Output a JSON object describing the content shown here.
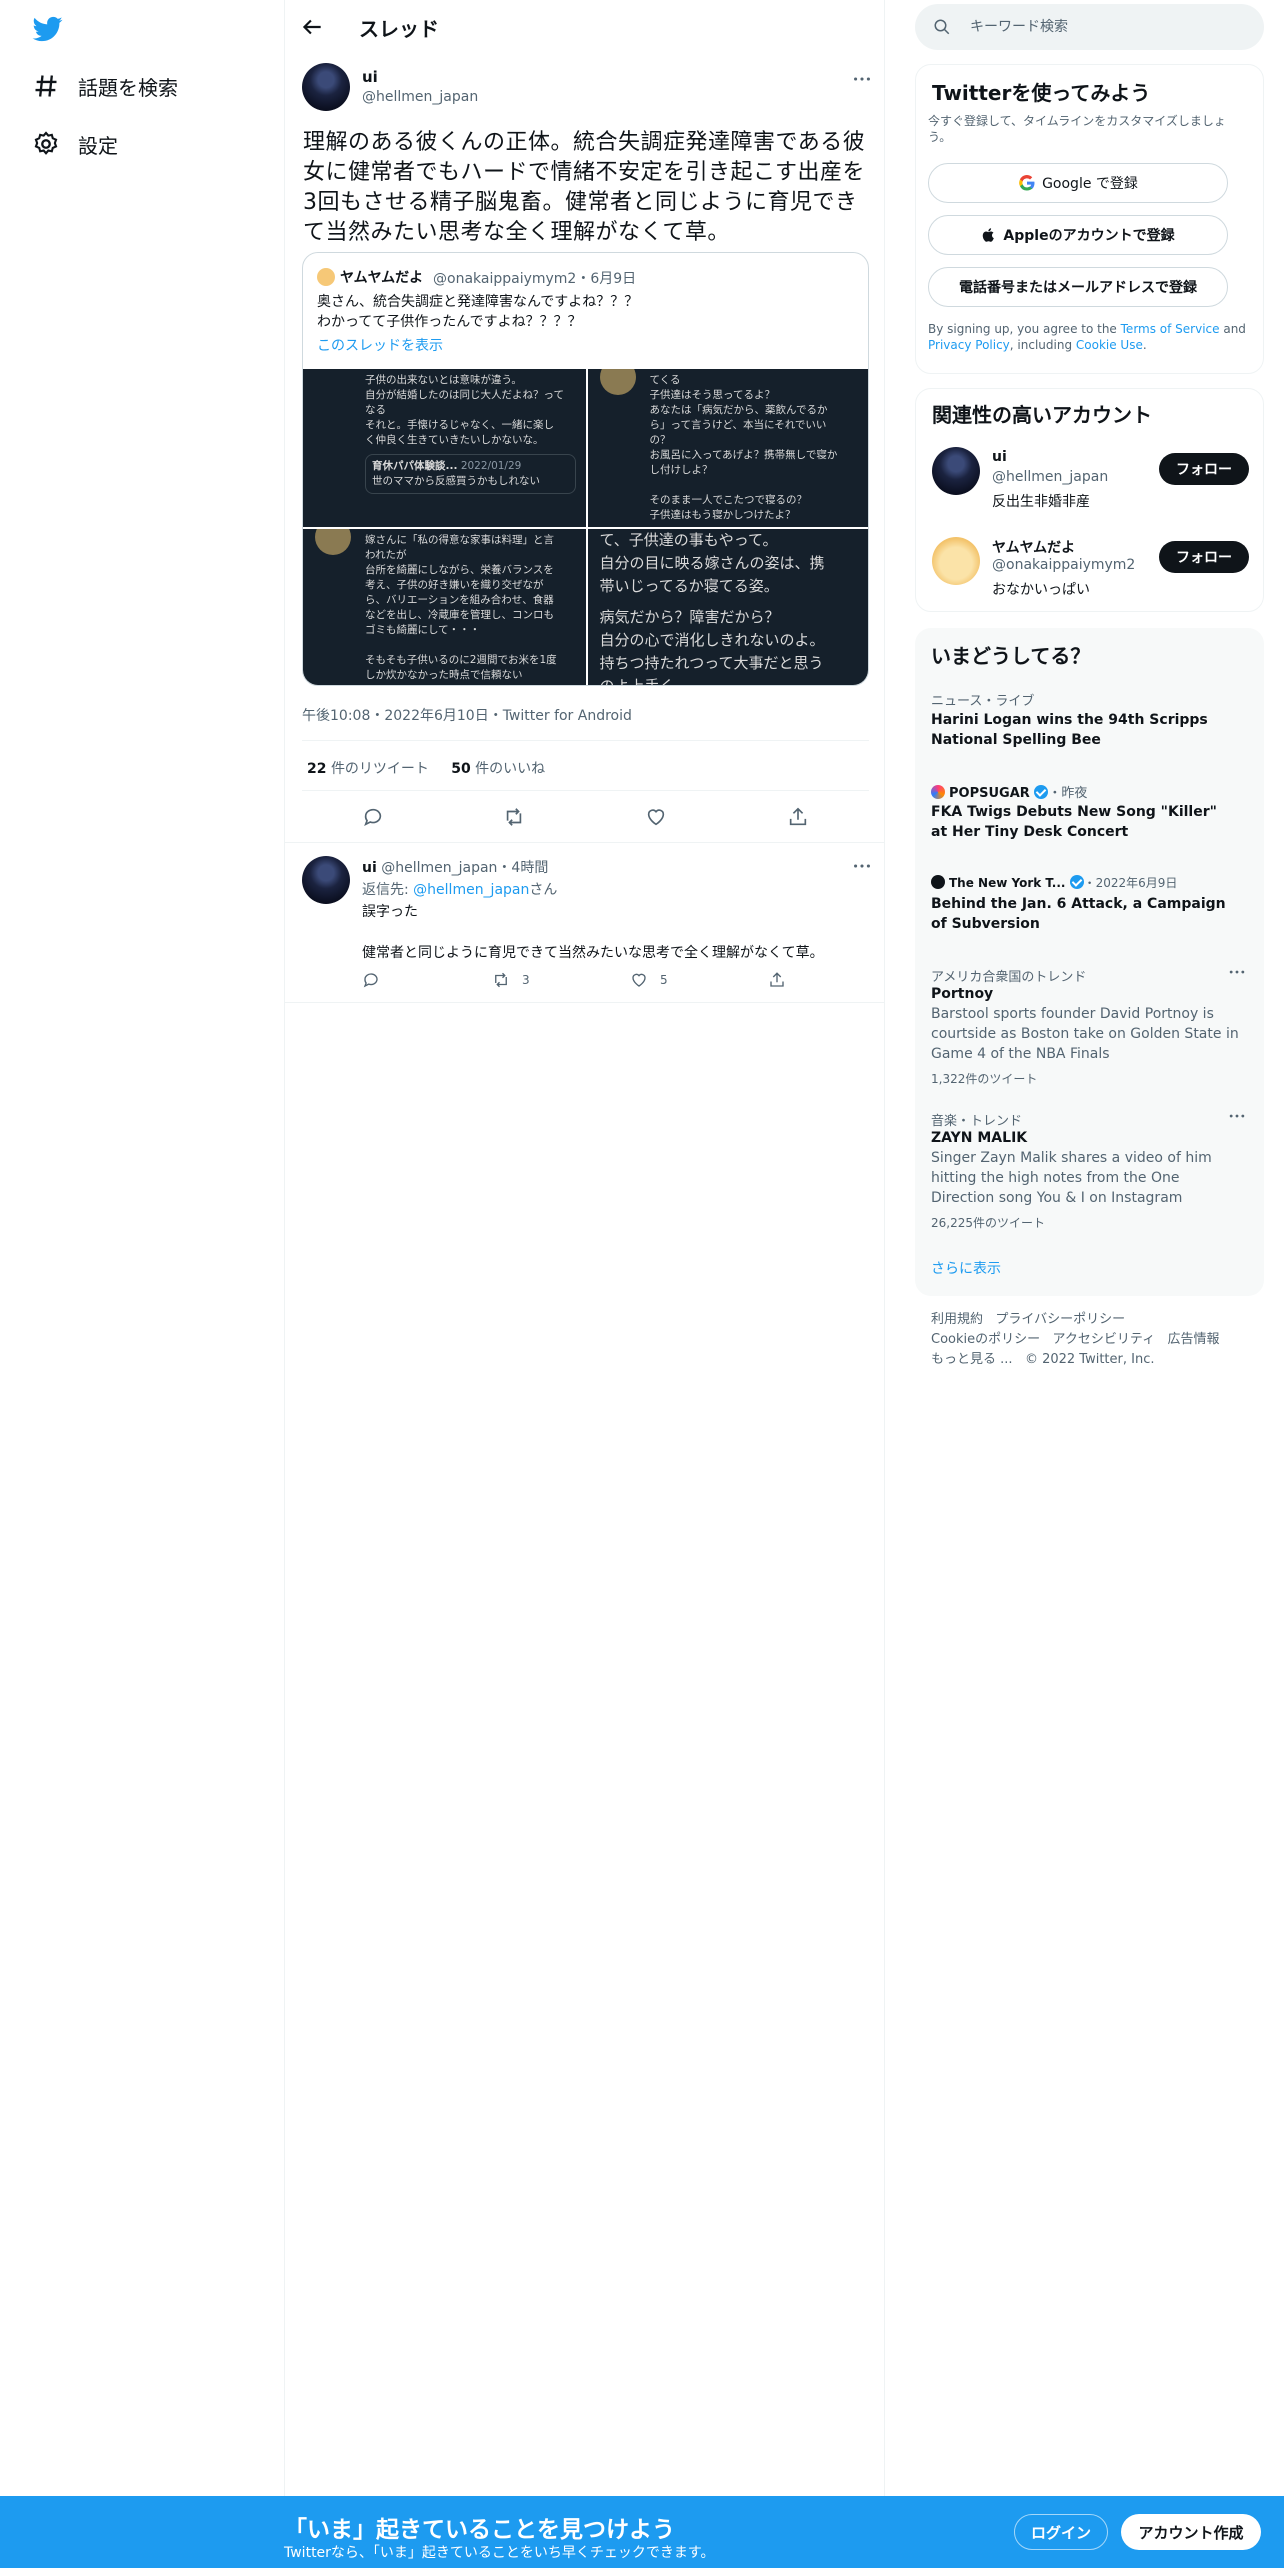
{
  "nav": {
    "explore_label": "話題を検索",
    "settings_label": "設定"
  },
  "header": {
    "title": "スレッド"
  },
  "main_tweet": {
    "name": "ui",
    "handle": "@hellmen_japan",
    "text": "理解のある彼くんの正体。統合失調症発達障害である彼女に健常者でもハードで情緒不安定を引き起こす出産を3回もさせる精子脳鬼畜。健常者と同じように育児できて当然みたい思考な全く理解がなくて草。",
    "timestamp": "午後10:08・2022年6月10日・Twitter for Android",
    "retweets_count": "22",
    "retweets_label": "件のリツイート",
    "likes_count": "50",
    "likes_label": "件のいいね"
  },
  "quote": {
    "name": "ヤムヤムだよ",
    "meta": "@onakaippaiymym2・6月9日",
    "line1": "奥さん、統合失調症と発達障害なんですよね？？？",
    "line2": "わかってて子供作ったんですよね？？？？",
    "link": "このスレッドを表示",
    "images": [
      {
        "lines": [
          "子供の出来ないとは意味が違う。",
          "自分が結婚したのは同じ大人だよね？って",
          "なる",
          "",
          "それと。手懐けるじゃなく、一緒に楽し",
          "く仲良く生きていきたいしかないな。"
        ],
        "embed_name": "育休パパ体験談...",
        "embed_date": "2022/01/29",
        "embed_text": "世のママから反感買うかもしれない"
      },
      {
        "lines": [
          "てくる",
          "子供達はそう思ってるよ？",
          "あなたは「病気だから、薬飲んでるか",
          "ら」って言うけど、本当にそれでいい",
          "の？",
          "お風呂に入ってあげよ？携帯無しで寝か",
          "し付けしよ？",
          "",
          "そのまま一人でこたつで寝るの？",
          "子供達はもう寝かしつけたよ？"
        ]
      },
      {
        "lines": [
          "嫁さんに「私の得意な家事は料理」と言",
          "われたが",
          "台所を綺麗にしながら、栄養バランスを",
          "考え、子供の好き嫌いを織り交ぜなが",
          "ら、バリエーションを組み合わせ、食器",
          "などを出し、冷蔵庫を管理し、コンロも",
          "ゴミも綺麗にして・・・",
          "",
          "そもそも子供いるのに2週間でお米を1度",
          "しか炊かなかった時点で信頼ない"
        ]
      },
      {
        "lines": [
          "て、子供達の事もやって。",
          "自分の目に映る嫁さんの姿は、携",
          "帯いじってるか寝てる姿。",
          "",
          "病気だから？障害だから？",
          "自分の心で消化しきれないのよ。",
          "持ちつ持たれつって大事だと思う",
          "のよ上手く、"
        ]
      }
    ]
  },
  "reply": {
    "name": "ui",
    "handle_time": "@hellmen_japan・4時間",
    "replying_prefix": "返信先: ",
    "replying_to": "@hellmen_japan",
    "replying_suffix": "さん",
    "line1": "誤字った",
    "line2": "健常者と同じように育児できて当然みたいな思考で全く理解がなくて草。",
    "retweets": "3",
    "likes": "5"
  },
  "search": {
    "placeholder": "キーワード検索"
  },
  "signup_panel": {
    "title": "Twitterを使ってみよう",
    "subtitle": "今すぐ登録して、タイムラインをカスタマイズしましょう。",
    "google_label": "Google で登録",
    "apple_label": "Appleのアカウントで登録",
    "phone_label": "電話番号またはメールアドレスで登録",
    "terms_prefix": "By signing up, you agree to the ",
    "terms_link": "Terms of Service",
    "terms_and": " and ",
    "privacy_link": "Privacy Policy",
    "terms_including": ", including ",
    "cookie_link": "Cookie Use",
    "terms_end": "."
  },
  "accounts_panel": {
    "title": "関連性の高いアカウント",
    "accounts": [
      {
        "name": "ui",
        "handle": "@hellmen_japan",
        "bio": "反出生非婚非産",
        "follow_label": "フォロー"
      },
      {
        "name": "ヤムヤムだよ",
        "handle": "@onakaippaiymym2",
        "bio": "おなかいっぱい",
        "follow_label": "フォロー"
      }
    ]
  },
  "trends_panel": {
    "title": "いまどうしてる？",
    "items": [
      {
        "category": "ニュース・ライブ",
        "title": "Harini Logan wins the 94th Scripps National Spelling Bee"
      },
      {
        "source": "POPSUGAR",
        "time": "・昨夜",
        "title": "FKA Twigs Debuts New Song \"Killer\" at Her Tiny Desk Concert"
      },
      {
        "source": "The New York T...",
        "time": "・2022年6月9日",
        "title": "Behind the Jan. 6 Attack, a Campaign of Subversion"
      },
      {
        "category": "アメリカ合衆国のトレンド",
        "title": "Portnoy",
        "desc": "Barstool sports founder David Portnoy is courtside as Boston take on Golden State in Game 4 of the NBA Finals",
        "count": "1,322件のツイート"
      },
      {
        "category": "音楽・トレンド",
        "title": "ZAYN MALIK",
        "desc": "Singer Zayn Malik shares a video of him hitting the high notes from the One Direction song You & I on Instagram",
        "count": "26,225件のツイート"
      }
    ],
    "show_more": "さらに表示"
  },
  "footer": {
    "terms": "利用規約",
    "privacy": "プライバシーポリシー",
    "cookie": "Cookieのポリシー",
    "accessibility": "アクセシビリティ",
    "ads": "広告情報",
    "more": "もっと見る ...",
    "copyright": "© 2022 Twitter, Inc."
  },
  "bottom_bar": {
    "title": "「いま」起きていることを見つけよう",
    "subtitle": "Twitterなら、「いま」起きていることをいち早くチェックできます。",
    "login_label": "ログイン",
    "signup_label": "アカウント作成"
  },
  "colors": {
    "brand": "#1d9bf0",
    "text": "#0f1419",
    "secondary": "#536471"
  }
}
